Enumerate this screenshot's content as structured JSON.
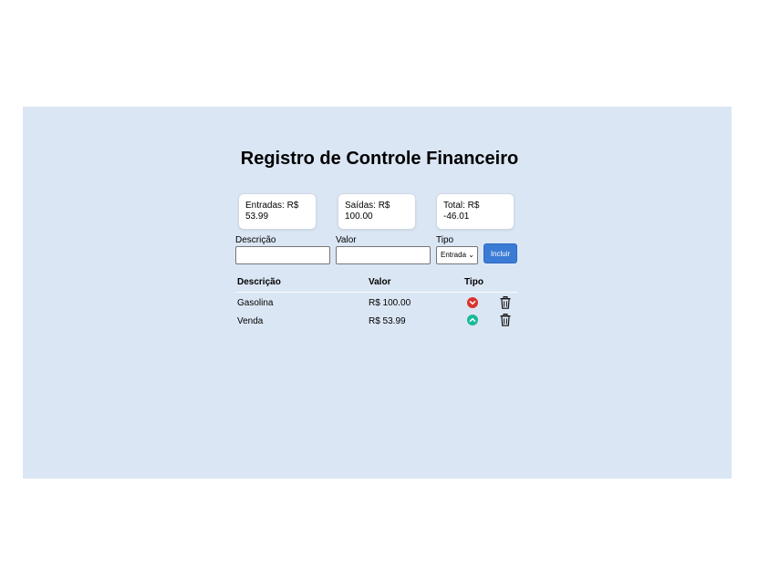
{
  "page": {
    "title": "Registro de Controle Financeiro"
  },
  "summary": {
    "entradas_label": "Entradas: R$",
    "entradas_value": "53.99",
    "saidas_label": "Saídas: R$",
    "saidas_value": "100.00",
    "total_label": "Total: R$",
    "total_value": "-46.01"
  },
  "form": {
    "descricao_label": "Descrição",
    "valor_label": "Valor",
    "tipo_label": "Tipo",
    "tipo_selected": "Entrada",
    "submit_label": "Incluir"
  },
  "table": {
    "headers": {
      "descricao": "Descrição",
      "valor": "Valor",
      "tipo": "Tipo"
    },
    "rows": [
      {
        "descricao": "Gasolina",
        "valor": "R$ 100.00",
        "tipo_icon": "chevron-down-icon",
        "tipo_color": "#d9342b"
      },
      {
        "descricao": "Venda",
        "valor": "R$ 53.99",
        "tipo_icon": "chevron-up-icon",
        "tipo_color": "#1ab99a"
      }
    ]
  }
}
